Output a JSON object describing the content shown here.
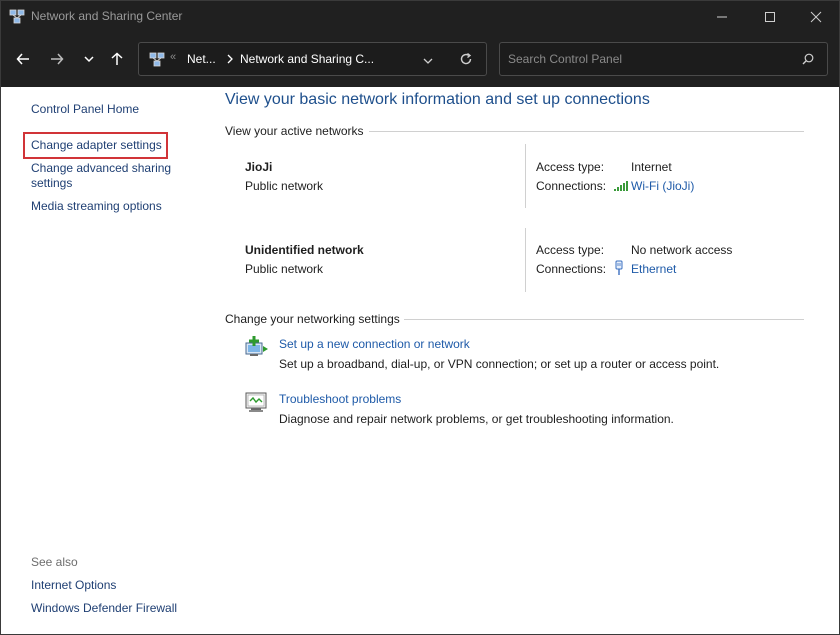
{
  "window": {
    "title": "Network and Sharing Center"
  },
  "address": {
    "crumbs": [
      "Net...",
      "Network and Sharing C..."
    ],
    "overflow": "«"
  },
  "search": {
    "placeholder": "Search Control Panel"
  },
  "sidebar": {
    "home": "Control Panel Home",
    "items": [
      "Change adapter settings",
      "Change advanced sharing settings",
      "Media streaming options"
    ],
    "see_also_label": "See also",
    "see_also": [
      "Internet Options",
      "Windows Defender Firewall"
    ]
  },
  "main": {
    "title": "View your basic network information and set up connections",
    "active_label": "View your active networks",
    "networks": [
      {
        "name": "JioJi",
        "type": "Public network",
        "access_label": "Access type:",
        "access": "Internet",
        "conn_label": "Connections:",
        "connection": "Wi-Fi (JioJi)",
        "icon": "wifi-signal-icon"
      },
      {
        "name": "Unidentified network",
        "type": "Public network",
        "access_label": "Access type:",
        "access": "No network access",
        "conn_label": "Connections:",
        "connection": "Ethernet",
        "icon": "ethernet-cable-icon"
      }
    ],
    "change_label": "Change your networking settings",
    "tasks": [
      {
        "title": "Set up a new connection or network",
        "desc": "Set up a broadband, dial-up, or VPN connection; or set up a router or access point.",
        "icon": "new-connection-icon"
      },
      {
        "title": "Troubleshoot problems",
        "desc": "Diagnose and repair network problems, or get troubleshooting information.",
        "icon": "troubleshoot-icon"
      }
    ]
  },
  "colors": {
    "highlight": "#d13438",
    "link": "#1e5aa8",
    "title": "#1e4f8c",
    "chrome": "#202020"
  }
}
